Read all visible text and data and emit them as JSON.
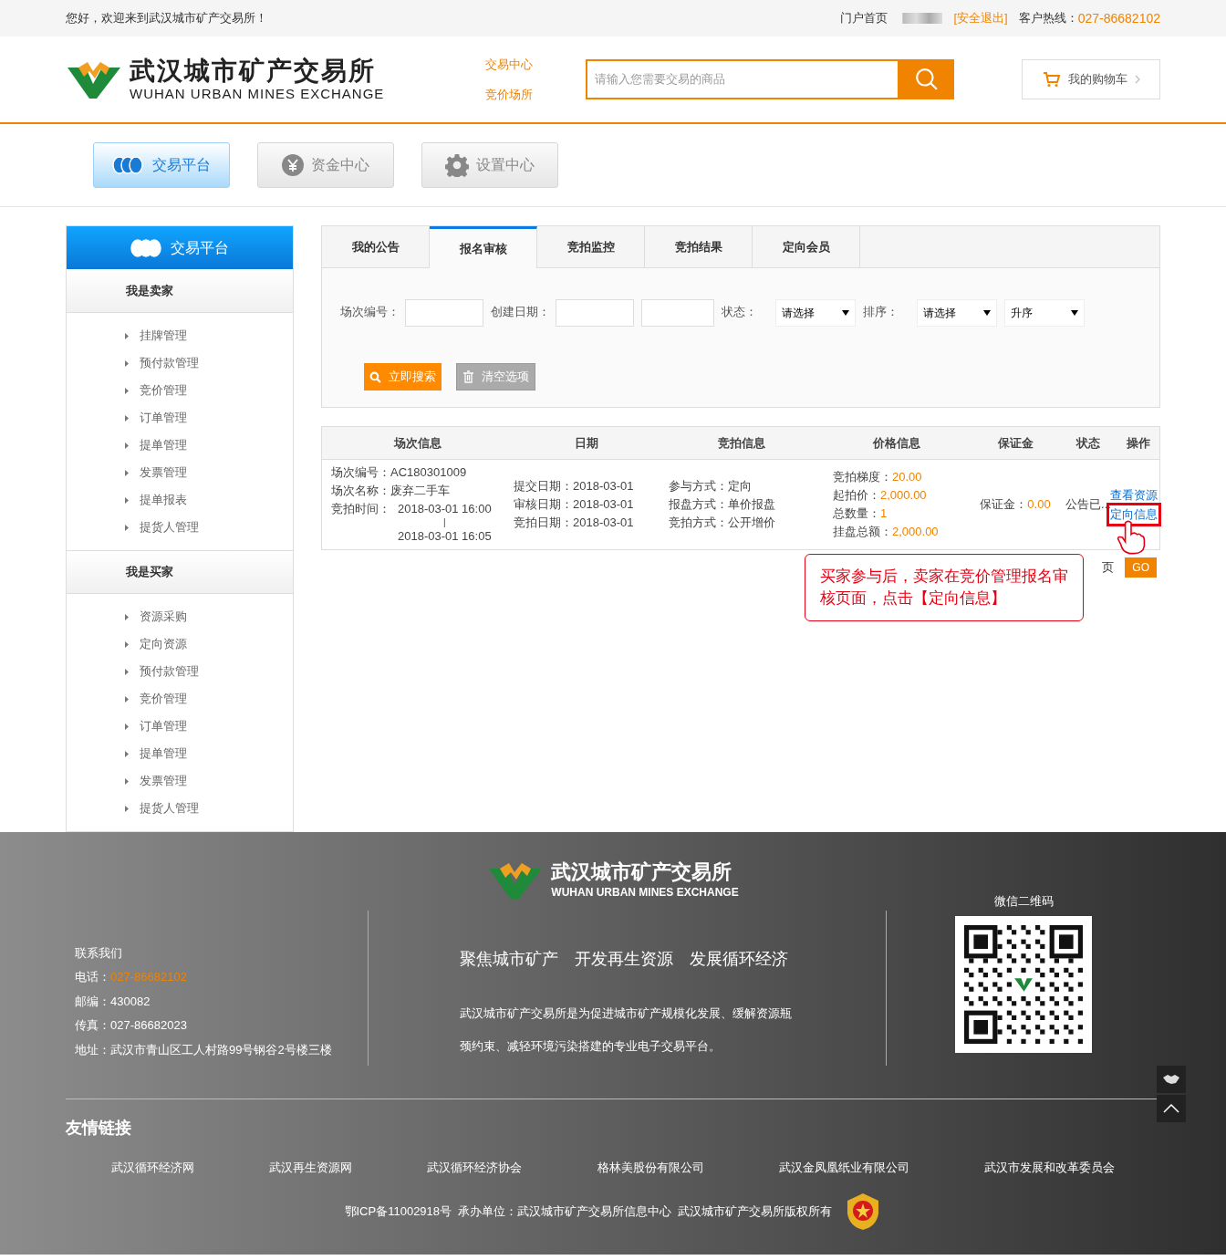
{
  "top_bar": {
    "greeting": "您好，欢迎来到武汉城市矿产交易所！",
    "links": [
      {
        "label": "门户首页",
        "kind": "plain"
      },
      {
        "label": "[安全退出]",
        "kind": "accent"
      }
    ],
    "hotline_label": "客户热线：",
    "hotline": "027-86682102"
  },
  "header": {
    "logo_title": "武汉城市矿产交易所",
    "logo_subtitle": "WUHAN URBAN MINES EXCHANGE",
    "nav_links": [
      "交易中心",
      "竞价场所"
    ],
    "search": {
      "placeholder": "请输入您需要交易的商品"
    },
    "cart": "我的购物车"
  },
  "main_tabs": [
    {
      "label": "交易平台",
      "selected": true
    },
    {
      "label": "资金中心",
      "selected": false
    },
    {
      "label": "设置中心",
      "selected": false
    }
  ],
  "sidebar": {
    "title": "交易平台",
    "groups": [
      {
        "title": "我是卖家",
        "items": [
          "挂牌管理",
          "预付款管理",
          "竞价管理",
          "订单管理",
          "提单管理",
          "发票管理",
          "提单报表",
          "提货人管理"
        ]
      },
      {
        "title": "我是买家",
        "items": [
          "资源采购",
          "定向资源",
          "预付款管理",
          "竞价管理",
          "订单管理",
          "提单管理",
          "发票管理",
          "提货人管理"
        ]
      }
    ]
  },
  "content_tabs": [
    {
      "label": "我的公告",
      "selected": false
    },
    {
      "label": "报名审核",
      "selected": true
    },
    {
      "label": "竞拍监控",
      "selected": false
    },
    {
      "label": "竞拍结果",
      "selected": false
    },
    {
      "label": "定向会员",
      "selected": false
    }
  ],
  "filters": [
    {
      "kind": "input",
      "label": "场次编号："
    },
    {
      "kind": "input",
      "label": "创建日期："
    },
    {
      "kind": "input"
    },
    {
      "kind": "select",
      "label": "状态：",
      "value": "请选择"
    },
    {
      "kind": "select",
      "label": "排序：",
      "value": "请选择"
    },
    {
      "kind": "select",
      "value": "升序"
    }
  ],
  "buttons": [
    {
      "label": "立即搜索",
      "kind": "primary"
    },
    {
      "label": "清空选项",
      "kind": "secondary"
    }
  ],
  "table": {
    "columns": [
      "场次信息",
      "日期",
      "竞拍信息",
      "价格信息",
      "保证金",
      "状态",
      "操作"
    ],
    "rows": [
      {
        "session": [
          {
            "label": "场次编号：",
            "value": "AC180301009"
          },
          {
            "label": "场次名称：",
            "value": "废弃二手车"
          }
        ],
        "time_label": "竞拍时间：",
        "time_start": "2018-03-01 16:00",
        "time_sep": "|",
        "time_end": "2018-03-01 16:05",
        "dates": [
          "提交日期：2018-03-01",
          "审核日期：2018-03-01",
          "竞拍日期：2018-03-01"
        ],
        "auction": [
          "参与方式：定向",
          "报盘方式：单价报盘",
          "竞拍方式：公开增价"
        ],
        "prices": [
          {
            "label": "竞拍梯度：",
            "value": "20.00"
          },
          {
            "label": "起拍价：",
            "value": "2,000.00"
          },
          {
            "label": "总数量：",
            "value": "1"
          },
          {
            "label": "挂盘总额：",
            "value": "2,000.00"
          }
        ],
        "deposit_label": "保证金：",
        "deposit": "0.00",
        "status": "公告已...",
        "actions": [
          {
            "label": "查看资源",
            "highlighted": false
          },
          {
            "label": "定向信息",
            "highlighted": true
          }
        ]
      }
    ]
  },
  "pagination": {
    "suffix": "页",
    "go": "GO"
  },
  "callout": "买家参与后，卖家在竞价管理报名审核页面，点击【定向信息】",
  "footer": {
    "logo_title": "武汉城市矿产交易所",
    "logo_subtitle": "WUHAN URBAN MINES EXCHANGE",
    "contact_title": "联系我们",
    "contacts": [
      {
        "label": "电话：",
        "value": "027-86682102",
        "accent": true
      },
      {
        "label": "邮编：",
        "value": "430082",
        "accent": false
      },
      {
        "label": "传真：",
        "value": "027-86682023",
        "accent": false
      },
      {
        "label": "地址：",
        "value": "武汉市青山区工人村路99号钢谷2号楼三楼",
        "accent": false
      }
    ],
    "slogans": [
      "聚焦城市矿产",
      "开发再生资源",
      "发展循环经济"
    ],
    "description": "武汉城市矿产交易所是为促进城市矿产规模化发展、缓解资源瓶颈约束、减轻环境污染搭建的专业电子交易平台。",
    "qr_label": "微信二维码",
    "links_title": "友情链接",
    "links": [
      "武汉循环经济网",
      "武汉再生资源网",
      "武汉循环经济协会",
      "格林美股份有限公司",
      "武汉金凤凰纸业有限公司",
      "武汉市发展和改革委员会"
    ],
    "copyright": "鄂ICP备11002918号  承办单位：武汉城市矿产交易所信息中心  武汉城市矿产交易所版权所有"
  }
}
